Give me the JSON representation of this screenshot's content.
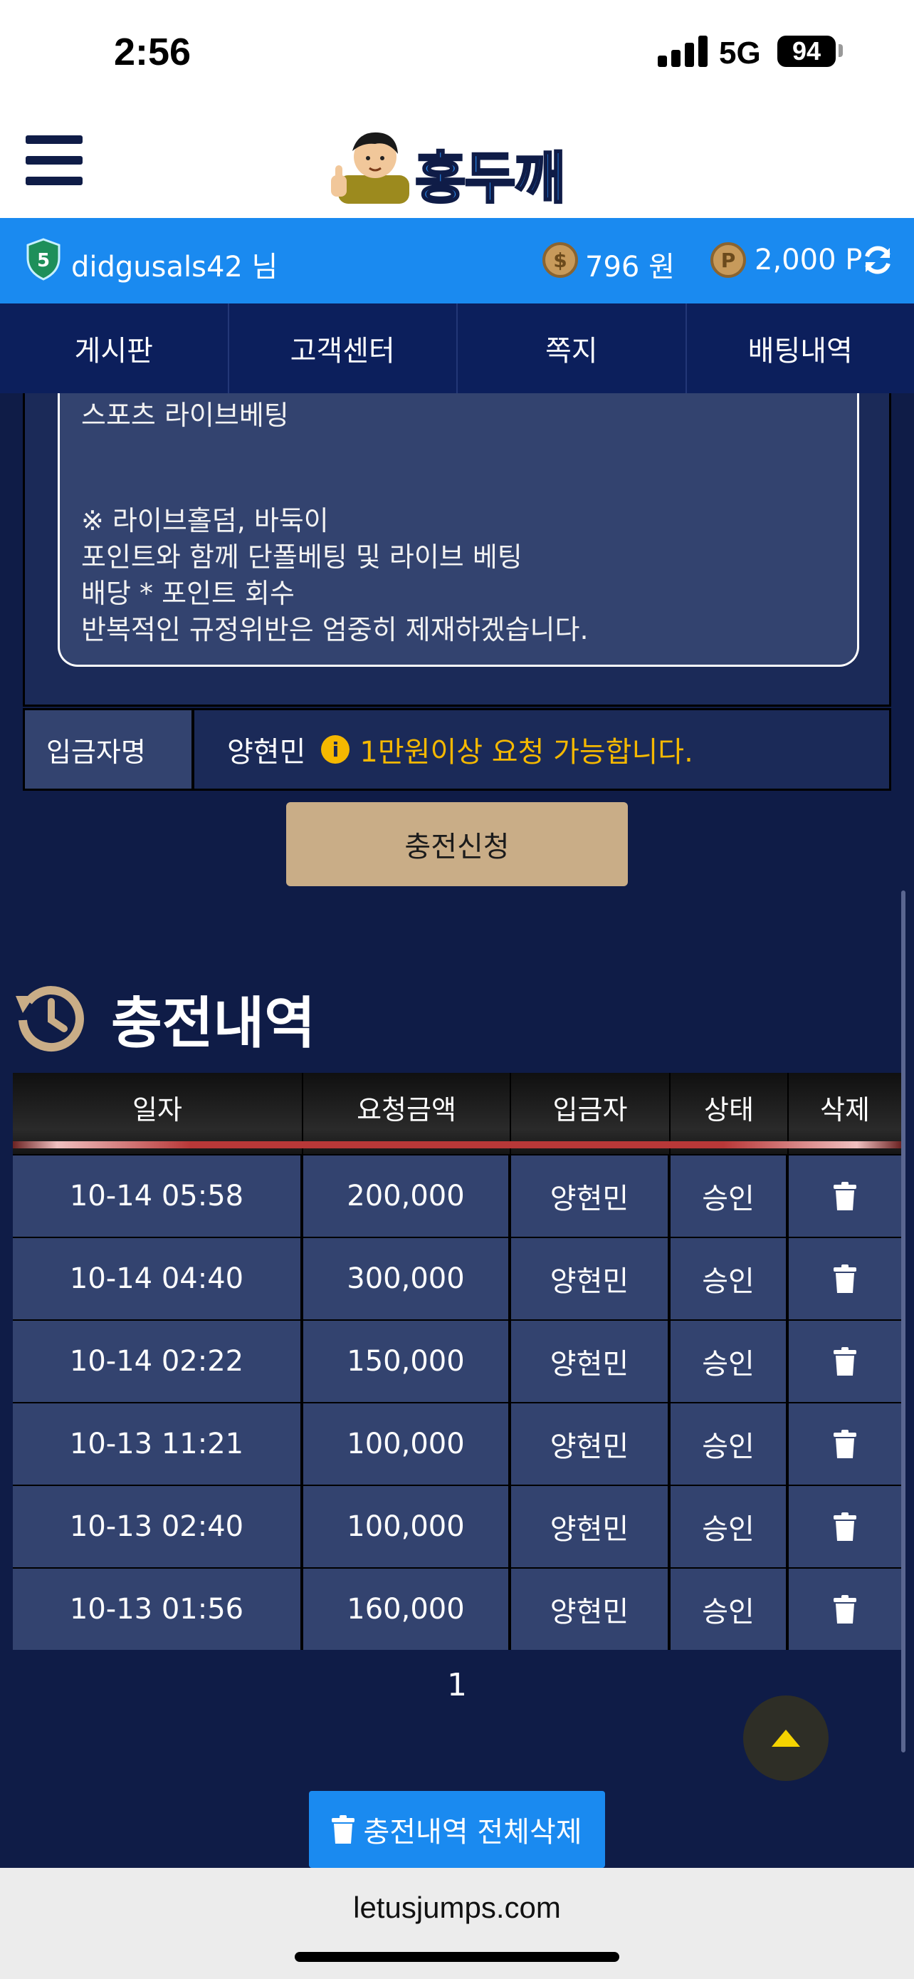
{
  "status_bar": {
    "time": "2:56",
    "network": "5G",
    "battery": "94"
  },
  "header": {
    "logo_text": "홍두깨"
  },
  "user_bar": {
    "username": "didgusals42 님",
    "level_badge": "5",
    "money": "796 원",
    "money_icon_glyph": "$",
    "points": "2,000 P",
    "points_icon_glyph": "P"
  },
  "nav": {
    "items": [
      {
        "label": "게시판"
      },
      {
        "label": "고객센터"
      },
      {
        "label": "쪽지"
      },
      {
        "label": "배팅내역"
      }
    ]
  },
  "notice": {
    "lines": [
      "스포츠 라이브베팅",
      "※ 라이브홀덤, 바둑이",
      "포인트와 함께 단폴베팅 및 라이브 베팅",
      "배당 * 포인트 회수",
      "반복적인 규정위반은 엄중히 제재하겠습니다."
    ]
  },
  "depositor": {
    "label": "입금자명",
    "name": "양현민",
    "warning": "1만원이상 요청 가능합니다."
  },
  "charge_button_label": "충전신청",
  "history": {
    "title": "충전내역",
    "columns": [
      "일자",
      "요청금액",
      "입금자",
      "상태",
      "삭제"
    ],
    "rows": [
      {
        "date": "10-14 05:58",
        "amount": "200,000",
        "depositor": "양현민",
        "status": "승인"
      },
      {
        "date": "10-14 04:40",
        "amount": "300,000",
        "depositor": "양현민",
        "status": "승인"
      },
      {
        "date": "10-14 02:22",
        "amount": "150,000",
        "depositor": "양현민",
        "status": "승인"
      },
      {
        "date": "10-13 11:21",
        "amount": "100,000",
        "depositor": "양현민",
        "status": "승인"
      },
      {
        "date": "10-13 02:40",
        "amount": "100,000",
        "depositor": "양현민",
        "status": "승인"
      },
      {
        "date": "10-13 01:56",
        "amount": "160,000",
        "depositor": "양현민",
        "status": "승인"
      }
    ],
    "page": "1",
    "delete_all_label": "충전내역 전체삭제"
  },
  "browser": {
    "url": "letusjumps.com"
  },
  "colors": {
    "accent_blue": "#1a8af0",
    "navy": "#0f1c47",
    "nav_navy": "#0c1f5c",
    "warning_yellow": "#f5b800",
    "button_tan": "#c9ad87"
  }
}
